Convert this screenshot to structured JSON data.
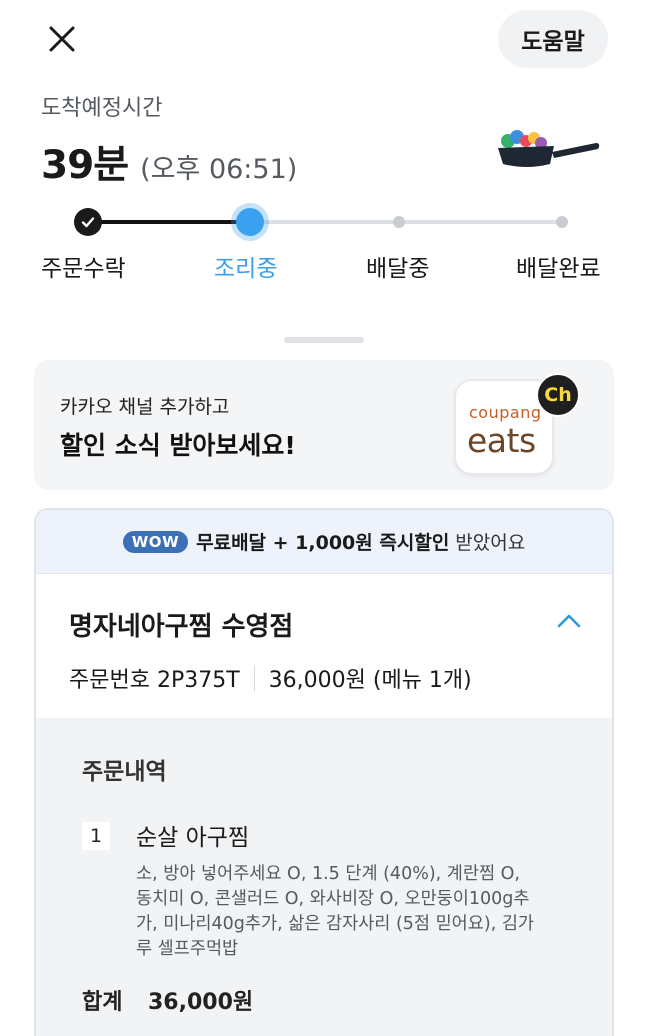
{
  "header": {
    "help_label": "도움말"
  },
  "eta": {
    "label": "도착예정시간",
    "minutes": "39분",
    "clock": "(오후 06:51)"
  },
  "progress": {
    "steps": [
      {
        "label": "주문수락",
        "state": "done"
      },
      {
        "label": "조리중",
        "state": "active"
      },
      {
        "label": "배달중",
        "state": "pending"
      },
      {
        "label": "배달완료",
        "state": "pending"
      }
    ]
  },
  "banner": {
    "subtitle": "카카오 채널 추가하고",
    "title": "할인 소식 받아보세요!",
    "app_brand_top": "coupang",
    "app_brand_bottom": "eats",
    "channel_badge": "Ch"
  },
  "order": {
    "benefit": {
      "badge": "WOW",
      "highlight": "무료배달 + 1,000원 즉시할인",
      "rest": "받았어요"
    },
    "store_name": "명자네아구찜 수영점",
    "order_number": "주문번호 2P375T",
    "price_summary": "36,000원 (메뉴 1개)",
    "details": {
      "title": "주문내역",
      "items": [
        {
          "qty": "1",
          "name": "순살 아구찜",
          "options": "소, 방아 넣어주세요 O, 1.5 단계 (40%), 계란찜 O, 동치미 O, 콘샐러드 O, 와사비장 O, 오만둥이100g추가, 미나리40g추가, 삶은 감자사리 (5점 믿어요), 김가루 셀프주먹밥"
        }
      ],
      "total_label": "합계",
      "total_value": "36,000원"
    }
  },
  "colors": {
    "accent": "#3aa0f0",
    "wow_badge": "#3b6fb6",
    "banner_bg": "#f4f5f7",
    "detail_bg": "#f2f3f5"
  },
  "icons": [
    "close-icon",
    "frying-pan-icon",
    "check-icon",
    "chevron-up-icon",
    "coupang-eats-app-icon",
    "kakao-channel-icon"
  ]
}
